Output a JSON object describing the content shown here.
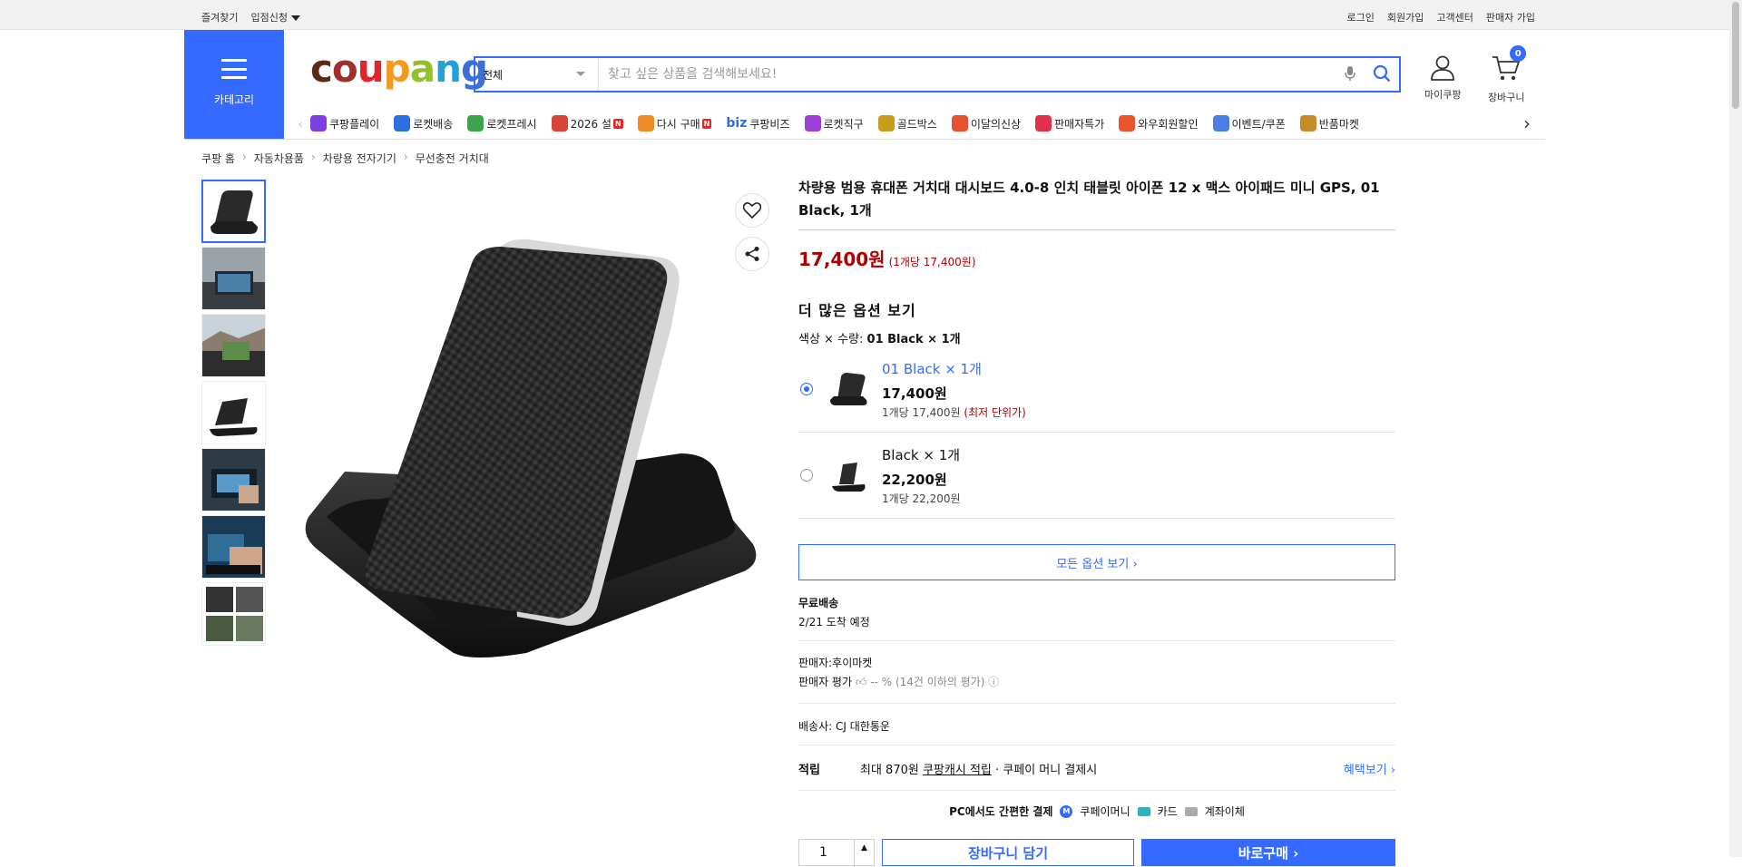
{
  "topbar": {
    "left": [
      "즐겨찾기",
      "입점신청"
    ],
    "right": [
      "로그인",
      "회원가입",
      "고객센터",
      "판매자 가입"
    ]
  },
  "header": {
    "category_label": "카테고리",
    "logo": "coupang",
    "search": {
      "category": "전체",
      "placeholder": "찾고 싶은 상품을 검색해보세요!"
    },
    "mycoupang": "마이쿠팡",
    "cart": "장바구니",
    "cart_count": "0"
  },
  "nav": [
    {
      "label": "쿠팡플레이",
      "icon": "play-icon",
      "color": "#7b3fe4"
    },
    {
      "label": "로켓배송",
      "icon": "rocket-icon",
      "color": "#2e6fe0"
    },
    {
      "label": "로켓프레시",
      "icon": "rocket-fresh-icon",
      "color": "#3aa54a"
    },
    {
      "label": "2026 설",
      "icon": "gift-icon",
      "color": "#d8443a",
      "badge": "N"
    },
    {
      "label": "다시 구매",
      "icon": "rebuy-icon",
      "color": "#f08a24",
      "badge": "N"
    },
    {
      "label": "쿠팡비즈",
      "icon": "biz-icon",
      "color": "#2e6fe0",
      "prefix": "biz"
    },
    {
      "label": "로켓직구",
      "icon": "global-icon",
      "color": "#9b3fd6"
    },
    {
      "label": "골드박스",
      "icon": "goldbox-icon",
      "color": "#c99c1c"
    },
    {
      "label": "이달의신상",
      "icon": "new-icon",
      "color": "#e65130"
    },
    {
      "label": "판매자특가",
      "icon": "percent-icon",
      "color": "#e0304a"
    },
    {
      "label": "와우회원할인",
      "icon": "wow-icon",
      "color": "#e8552f"
    },
    {
      "label": "이벤트/쿠폰",
      "icon": "coupon-icon",
      "color": "#4b7de4"
    },
    {
      "label": "반품마켓",
      "icon": "market-icon",
      "color": "#c98a2a"
    }
  ],
  "breadcrumb": [
    "쿠팡 홈",
    "자동차용품",
    "차량용 전자기기",
    "무선충전 거치대"
  ],
  "product": {
    "title": "차량용 범용 휴대폰 거치대 대시보드 4.0-8 인치 태블릿 아이폰 12 x 맥스 아이패드 미니 GPS, 01 Black, 1개",
    "price": "17,400원",
    "unit_price": "(1개당 17,400원)",
    "more_options": "더 많은 옵션 보기",
    "option_label": "색상 × 수량:",
    "option_value": "01 Black × 1개",
    "options": [
      {
        "name": "01 Black × 1개",
        "price": "17,400원",
        "unit": "1개당 17,400원",
        "lowest": "(최저 단위가)",
        "selected": true
      },
      {
        "name": "Black × 1개",
        "price": "22,200원",
        "unit": "1개당 22,200원",
        "lowest": "",
        "selected": false
      }
    ],
    "all_options": "모든 옵션 보기 ›",
    "shipping_title": "무료배송",
    "shipping_eta": "2/21 도착 예정",
    "seller": "판매자:후이마켓",
    "seller_rating_label": "판매자 평가",
    "seller_rating_value": "-- %",
    "seller_rating_note": "(14건 이하의 평가)",
    "carrier_label": "배송사:",
    "carrier": "CJ 대한통운",
    "points_label": "적립",
    "points_text_a": "최대 870원",
    "points_text_b": "쿠팡캐시 적립",
    "points_text_c": "· 쿠페이 머니 결제시",
    "benefit": "혜택보기 ›",
    "pay_title": "PC에서도 간편한 결제",
    "pay_money": "쿠페이머니",
    "pay_card": "카드",
    "pay_bank": "계좌이체",
    "qty": "1",
    "add_cart": "장바구니 담기",
    "buy_now": "바로구매 ›"
  }
}
